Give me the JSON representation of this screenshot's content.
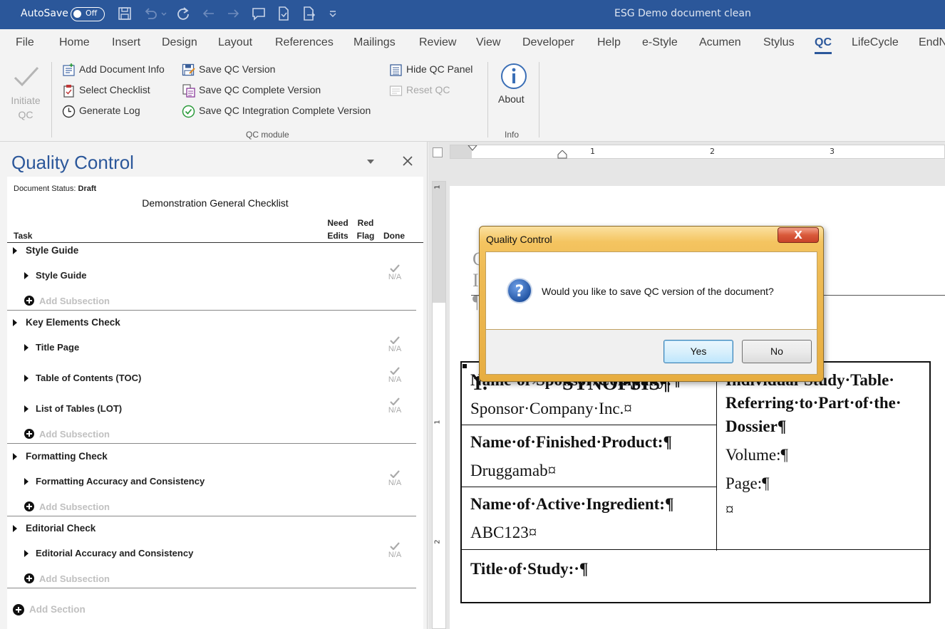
{
  "titlebar": {
    "autosave_label": "AutoSave",
    "autosave_state": "Off",
    "document_title": "ESG Demo document clean"
  },
  "tabs": [
    "File",
    "Home",
    "Insert",
    "Design",
    "Layout",
    "References",
    "Mailings",
    "Review",
    "View",
    "Developer",
    "Help",
    "e-Style",
    "Acumen",
    "Stylus",
    "QC",
    "LifeCycle",
    "EndN"
  ],
  "active_tab": "QC",
  "ribbon": {
    "initiate_qc": "Initiate QC",
    "add_document_info": "Add Document Info",
    "select_checklist": "Select Checklist",
    "generate_log": "Generate Log",
    "save_qc_version": "Save QC Version",
    "save_qc_complete_version": "Save QC Complete Version",
    "save_qc_integration_complete_version": "Save QC Integration Complete Version",
    "hide_qc_panel": "Hide QC Panel",
    "reset_qc": "Reset QC",
    "qc_module_group": "QC module",
    "about": "About",
    "info_group": "Info"
  },
  "qc_panel": {
    "title": "Quality Control",
    "status_label": "Document Status:",
    "status_value": "Draft",
    "checklist_title": "Demonstration General Checklist",
    "col_task": "Task",
    "col_need_edits_1": "Need",
    "col_need_edits_2": "Edits",
    "col_red_flag_1": "Red",
    "col_red_flag_2": "Flag",
    "col_done": "Done",
    "na_label": "N/A",
    "add_subsection": "Add Subsection",
    "add_section": "Add Section",
    "sections": [
      {
        "name": "Style Guide",
        "items": [
          "Style Guide"
        ]
      },
      {
        "name": "Key Elements Check",
        "items": [
          "Title Page",
          "Table of Contents (TOC)",
          "List of Tables (LOT)"
        ]
      },
      {
        "name": "Formatting Check",
        "items": [
          "Formatting Accuracy and Consistency"
        ]
      },
      {
        "name": "Editorial Check",
        "items": [
          "Editorial Accuracy and Consistency"
        ]
      }
    ]
  },
  "document": {
    "ruler_numbers": [
      "1",
      "2",
      "3"
    ],
    "vruler_numbers": [
      "1",
      "1",
      "2"
    ],
    "faint_lines": [
      "C",
      "I",
      "¶"
    ],
    "heading_number": "1.",
    "heading_arrow": "→",
    "heading_text": "SYNOPSIS¶",
    "table": {
      "sponsor_label": "Name·of·Sponsor/Company:¶",
      "sponsor_value": "Sponsor·Company·Inc.¤",
      "product_label": "Name·of·Finished·Product:¶",
      "product_value": "Druggamab¤",
      "ingredient_label": "Name·of·Active·Ingredient:¶",
      "ingredient_value": "ABC123¤",
      "right_line1": "Individual·Study·Table·",
      "right_line2": "Referring·to·Part·of·the·",
      "right_line3": "Dossier¶",
      "volume": "Volume:¶",
      "page": "Page:¶",
      "end_mark": "¤",
      "title_label": "Title·of·Study:·¶"
    }
  },
  "dialog": {
    "title": "Quality Control",
    "close": "X",
    "message": "Would you like to save QC version of the document?",
    "yes": "Yes",
    "no": "No"
  }
}
